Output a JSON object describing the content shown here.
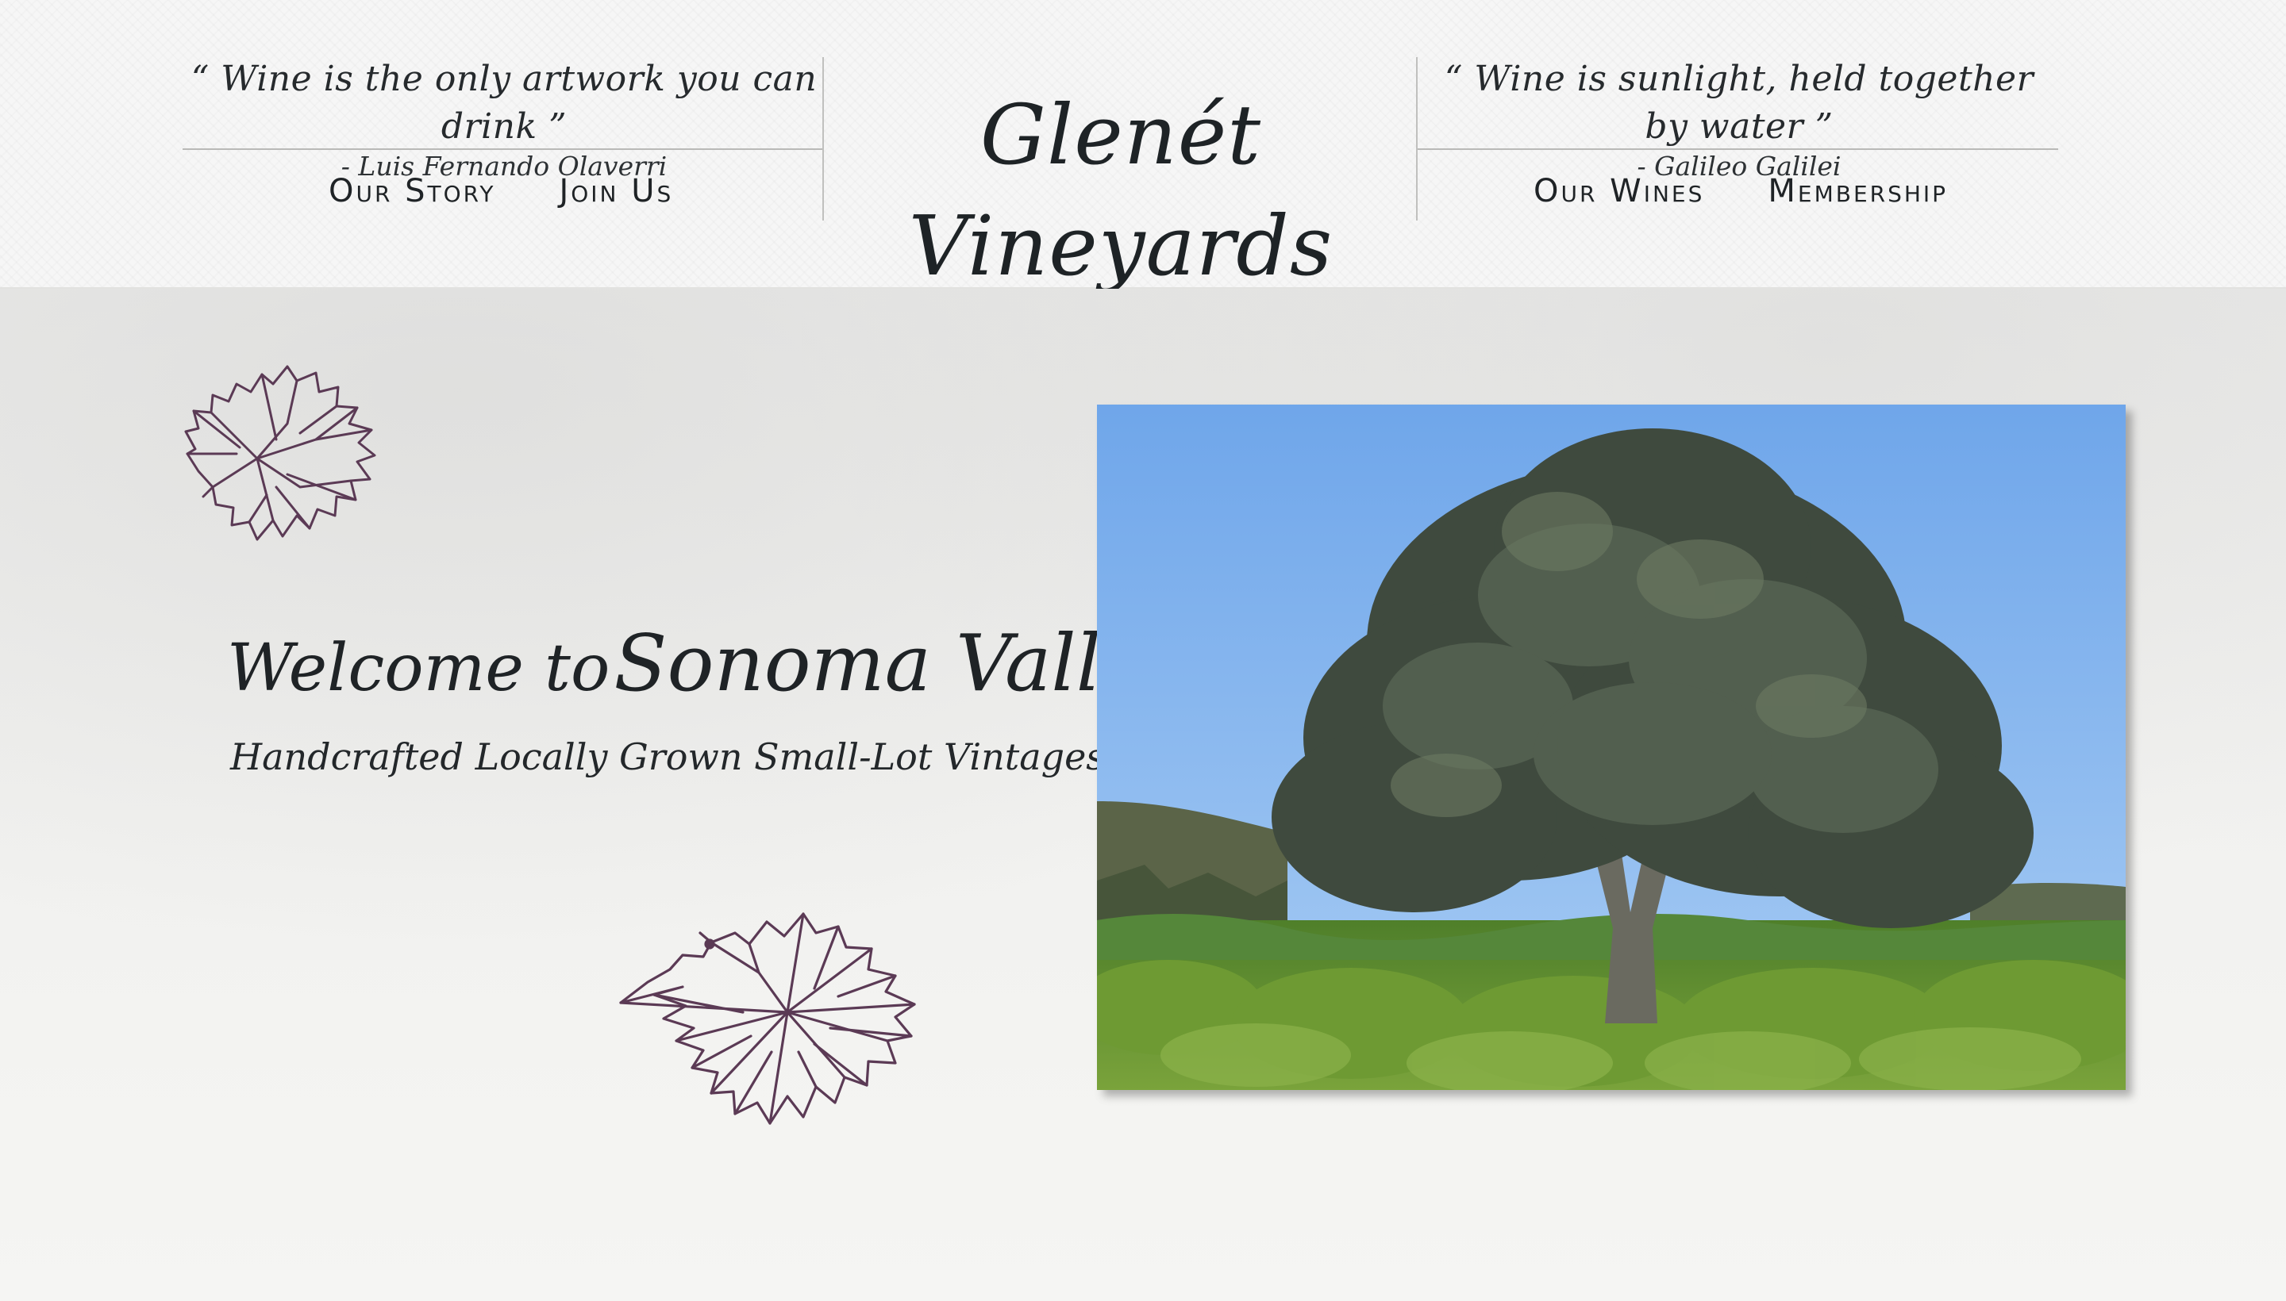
{
  "header": {
    "quote_left": {
      "text": "“ Wine is the only artwork you can drink ”",
      "author": "- Luis Fernando Olaverri"
    },
    "quote_right": {
      "text": "“ Wine is sunlight, held together by water ”",
      "author": "- Galileo Galilei"
    },
    "brand": "Glenét Vineyards",
    "nav_left": [
      "Our Story",
      "Join Us"
    ],
    "nav_right": [
      "Our Wines",
      "Membership"
    ]
  },
  "hero": {
    "welcome_prefix": "Welcome to",
    "welcome_place": "Sonoma Valley",
    "tagline": "Handcrafted Locally Grown Small-Lot Vintages"
  },
  "icons": {
    "leaf_top": "grape-leaf-icon",
    "leaf_bottom": "grape-leaf-icon"
  },
  "photo": {
    "subject": "oak tree in vineyard"
  },
  "colors": {
    "leaf_stroke": "#5b3a55",
    "text": "#1f2326",
    "sky": "#7fb3ef",
    "foliage": "#3f4a3e",
    "vines": "#5f8f2f"
  }
}
